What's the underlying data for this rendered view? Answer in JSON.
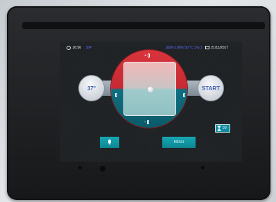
{
  "status_bar": {
    "time": "16:56",
    "mode": "SIP",
    "center_info": "100% 100% 50 °C  1% 1",
    "date": "21/11/2017"
  },
  "controls": {
    "left_button_label": "37°",
    "start_label": "START",
    "increase_label": "+",
    "decrease_label": "-",
    "menu_label": "MENU",
    "timer_value": "20'"
  },
  "icons": {
    "clock": "clock-icon",
    "calendar": "calendar-icon",
    "thermometer": "thermometer-icon",
    "microphone": "microphone-icon",
    "hourglass": "hourglass-icon"
  },
  "colors": {
    "hot": "#d8343c",
    "cold": "#0f6f80",
    "accent": "#5b6cff",
    "button": "#17a7b4"
  }
}
